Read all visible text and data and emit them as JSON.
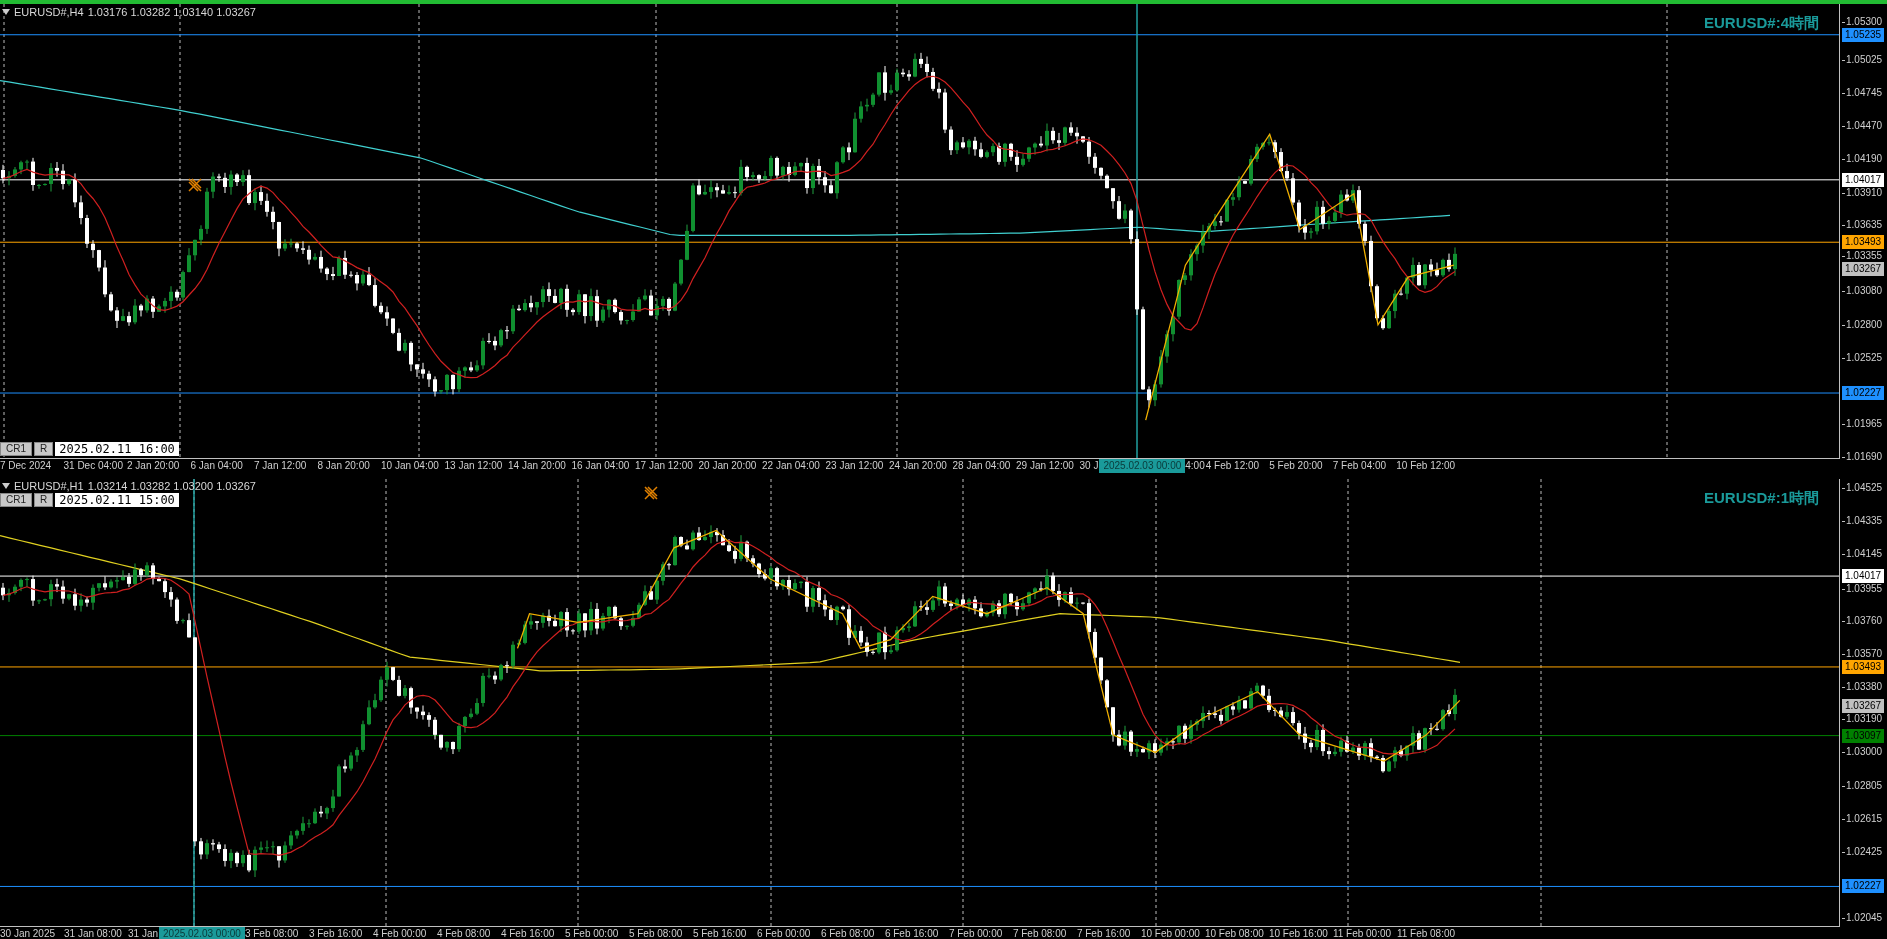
{
  "panes": [
    {
      "title": "EURUSD#,H4",
      "quote": "1.03176 1.03282 1.03140 1.03267",
      "label": "EURUSD#:4時間",
      "buttons": [
        "CR1",
        "R"
      ],
      "date_field": "2025.02.11 16:00",
      "price_ticks": [
        "1.05300",
        "1.05025",
        "1.04745",
        "1.04470",
        "1.04190",
        "1.03910",
        "1.03635",
        "1.03355",
        "1.03080",
        "1.02800",
        "1.02525",
        "1.01965",
        "1.01690"
      ],
      "price_markers": [
        {
          "price": "1.05235",
          "color": "#1e90ff",
          "kind": "level"
        },
        {
          "price": "1.04017",
          "color": "#ffffff",
          "kind": "level"
        },
        {
          "price": "1.03493",
          "color": "#ffa500",
          "kind": "level"
        },
        {
          "price": "1.03267",
          "color": "#c0c0c0",
          "kind": "bid"
        },
        {
          "price": "1.02227",
          "color": "#1e90ff",
          "kind": "level"
        }
      ],
      "time_axis": [
        {
          "kind": "label",
          "text": "7 Dec 2024"
        },
        {
          "kind": "label",
          "text": "31 Dec 04:00"
        },
        {
          "kind": "label",
          "text": "2 Jan 20:00"
        },
        {
          "kind": "label",
          "text": "6 Jan 04:00"
        },
        {
          "kind": "label",
          "text": "7 Jan 12:00"
        },
        {
          "kind": "label",
          "text": "8 Jan 20:00"
        },
        {
          "kind": "label",
          "text": "10 Jan 04:00"
        },
        {
          "kind": "label",
          "text": "13 Jan 12:00"
        },
        {
          "kind": "label",
          "text": "14 Jan 20:00"
        },
        {
          "kind": "label",
          "text": "16 Jan 04:00"
        },
        {
          "kind": "label",
          "text": "17 Jan 12:00"
        },
        {
          "kind": "label",
          "text": "20 Jan 20:00"
        },
        {
          "kind": "label",
          "text": "22 Jan 04:00"
        },
        {
          "kind": "label",
          "text": "23 Jan 12:00"
        },
        {
          "kind": "label",
          "text": "24 Jan 20:00"
        },
        {
          "kind": "label",
          "text": "28 Jan 04:00"
        },
        {
          "kind": "label",
          "text": "29 Jan 12:00"
        },
        {
          "kind": "partial",
          "text": "30 J"
        },
        {
          "kind": "cursor",
          "text": "2025.02.03 00:00"
        },
        {
          "kind": "partial",
          "text": "4:00"
        },
        {
          "kind": "label",
          "text": "4 Feb 12:00"
        },
        {
          "kind": "label",
          "text": "5 Feb 20:00"
        },
        {
          "kind": "label",
          "text": "7 Feb 04:00"
        },
        {
          "kind": "label",
          "text": "10 Feb 12:00"
        }
      ]
    },
    {
      "title": "EURUSD#,H1",
      "quote": "1.03214 1.03282 1.03200 1.03267",
      "label": "EURUSD#:1時間",
      "buttons": [
        "CR1",
        "R"
      ],
      "date_field": "2025.02.11 15:00",
      "price_ticks": [
        "1.04525",
        "1.04335",
        "1.04145",
        "1.03955",
        "1.03760",
        "1.03570",
        "1.03380",
        "1.03190",
        "1.03000",
        "1.02805",
        "1.02615",
        "1.02425",
        "1.02045"
      ],
      "price_markers": [
        {
          "price": "1.04017",
          "color": "#ffffff",
          "kind": "level"
        },
        {
          "price": "1.03493",
          "color": "#ffa500",
          "kind": "level"
        },
        {
          "price": "1.03267",
          "color": "#c0c0c0",
          "kind": "bid"
        },
        {
          "price": "1.03097",
          "color": "#008000",
          "kind": "level"
        },
        {
          "price": "1.02227",
          "color": "#1e90ff",
          "kind": "level"
        }
      ],
      "time_axis": [
        {
          "kind": "label",
          "text": "30 Jan 2025"
        },
        {
          "kind": "label",
          "text": "31 Jan 08:00"
        },
        {
          "kind": "partial",
          "text": "31 Jan"
        },
        {
          "kind": "cursor",
          "text": "2025.02.03 00:00"
        },
        {
          "kind": "label",
          "text": "3 Feb 08:00"
        },
        {
          "kind": "label",
          "text": "3 Feb 16:00"
        },
        {
          "kind": "label",
          "text": "4 Feb 00:00"
        },
        {
          "kind": "label",
          "text": "4 Feb 08:00"
        },
        {
          "kind": "label",
          "text": "4 Feb 16:00"
        },
        {
          "kind": "label",
          "text": "5 Feb 00:00"
        },
        {
          "kind": "label",
          "text": "5 Feb 08:00"
        },
        {
          "kind": "label",
          "text": "5 Feb 16:00"
        },
        {
          "kind": "label",
          "text": "6 Feb 00:00"
        },
        {
          "kind": "label",
          "text": "6 Feb 08:00"
        },
        {
          "kind": "label",
          "text": "6 Feb 16:00"
        },
        {
          "kind": "label",
          "text": "7 Feb 00:00"
        },
        {
          "kind": "label",
          "text": "7 Feb 08:00"
        },
        {
          "kind": "label",
          "text": "7 Feb 16:00"
        },
        {
          "kind": "label",
          "text": "10 Feb 00:00"
        },
        {
          "kind": "label",
          "text": "10 Feb 08:00"
        },
        {
          "kind": "label",
          "text": "10 Feb 16:00"
        },
        {
          "kind": "label",
          "text": "11 Feb 00:00"
        },
        {
          "kind": "label",
          "text": "11 Feb 08:00"
        }
      ]
    }
  ]
}
